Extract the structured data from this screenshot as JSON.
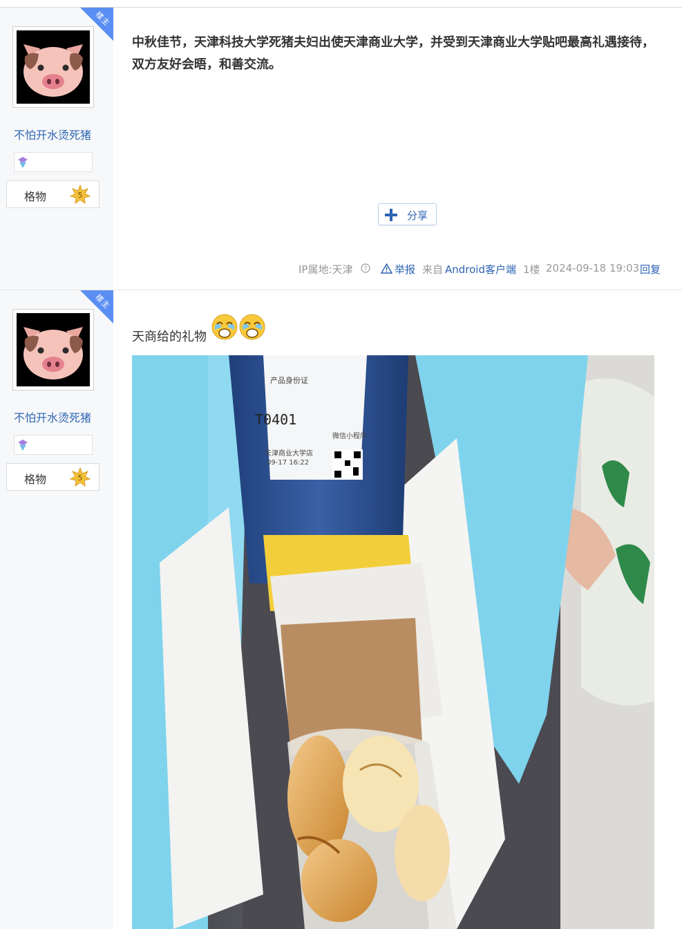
{
  "posts": [
    {
      "badge": "楼主",
      "username": "不怕开水烫死猪",
      "grade_label": "格物",
      "grade_level": "5",
      "text": "中秋佳节，天津科技大学死猪夫妇出使天津商业大学，并受到天津商业大学贴吧最高礼遇接待，双方友好会晤，和善交流。",
      "share_label": "分享",
      "meta": {
        "ip": "IP属地:天津",
        "report": "举报",
        "source_prefix": "来自",
        "source_client": "Android客户端",
        "floor": "1楼",
        "time": "2024-09-18 19:03",
        "reply": "回复"
      }
    },
    {
      "badge": "楼主",
      "username": "不怕开水烫死猪",
      "grade_label": "格物",
      "grade_level": "5",
      "text": "天商给的礼物",
      "photo": {
        "bottle_code": "T0401",
        "bottle_lines": [
          "产品身份证",
          "天津商业大学店",
          "09-17 16:22",
          "微信小程序"
        ]
      }
    }
  ],
  "colors": {
    "link_blue": "#2d64b3",
    "badge_blue": "#5a8ef2",
    "sidebar_bg": "#f7f8fa",
    "gift_bag_cyan": "#7fd3ec"
  }
}
